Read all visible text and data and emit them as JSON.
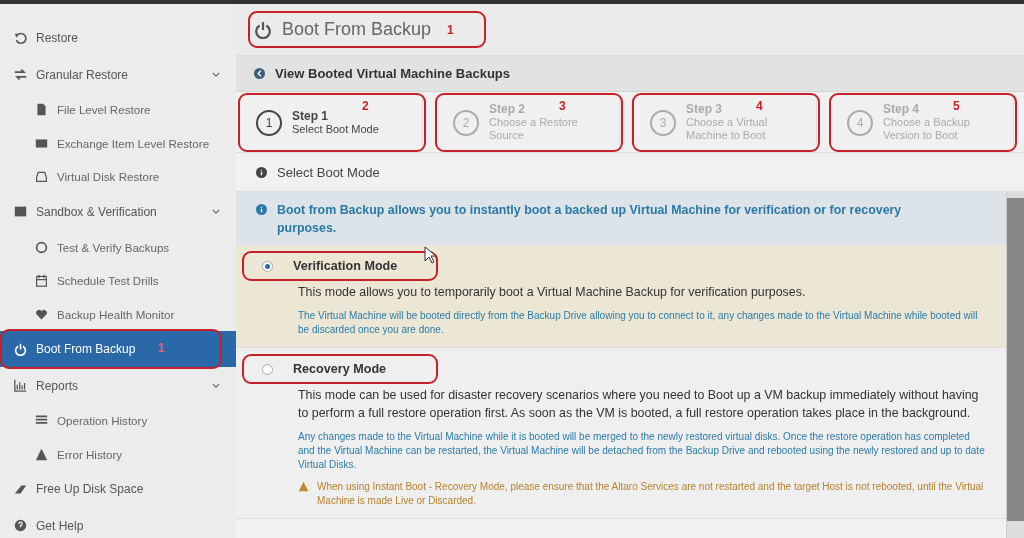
{
  "sidebar": {
    "items": [
      {
        "label": "Restore",
        "selected": false
      },
      {
        "label": "Granular Restore",
        "selected": false,
        "expanded": true,
        "children": [
          {
            "label": "File Level Restore",
            "selected": false
          },
          {
            "label": "Exchange Item Level Restore",
            "selected": false
          },
          {
            "label": "Virtual Disk Restore",
            "selected": false
          }
        ]
      },
      {
        "label": "Sandbox & Verification",
        "selected": false,
        "expanded": true,
        "children": [
          {
            "label": "Test & Verify Backups",
            "selected": false
          },
          {
            "label": "Schedule Test Drills",
            "selected": false
          },
          {
            "label": "Backup Health Monitor",
            "selected": false
          }
        ]
      },
      {
        "label": "Boot From Backup",
        "selected": true,
        "highlighted": true,
        "callout": "1"
      },
      {
        "label": "Reports",
        "selected": false,
        "expanded": true,
        "children": [
          {
            "label": "Operation History",
            "selected": false
          },
          {
            "label": "Error History",
            "selected": false
          }
        ]
      },
      {
        "label": "Free Up Disk Space",
        "selected": false
      },
      {
        "label": "Get Help",
        "selected": false
      }
    ]
  },
  "page": {
    "title": "Boot From Backup",
    "callout": "1"
  },
  "back_link": "View Booted Virtual Machine Backups",
  "steps": [
    {
      "number": "1",
      "title": "Step 1",
      "subtitle": "Select Boot Mode",
      "selected": true,
      "callout": "2"
    },
    {
      "number": "2",
      "title": "Step 2",
      "subtitle": "Choose a Restore Source",
      "selected": false,
      "callout": "3"
    },
    {
      "number": "3",
      "title": "Step 3",
      "subtitle": "Choose a Virtual Machine to Boot",
      "selected": false,
      "callout": "4"
    },
    {
      "number": "4",
      "title": "Step 4",
      "subtitle": "Choose a Backup Version to Boot",
      "selected": false,
      "callout": "5"
    }
  ],
  "section": {
    "title": "Select Boot Mode"
  },
  "info": "Boot from Backup allows you to instantly boot a backed up Virtual Machine for verification or for recovery purposes.",
  "modes": [
    {
      "label": "Verification Mode",
      "selected": true,
      "highlighted": true,
      "description": "This mode allows you to temporarily boot a Virtual Machine Backup for verification purposes.",
      "note": "The Virtual Machine will be booted directly from the Backup Drive allowing you to connect to it, any changes made to the Virtual Machine while booted will be discarded once you are done."
    },
    {
      "label": "Recovery Mode",
      "selected": false,
      "highlighted": true,
      "description": "This mode can be used for disaster recovery scenarios where you need to Boot up a VM backup immediately without having to perform a full restore operation first. As soon as the VM is booted, a full restore operation takes place in the background.",
      "note": "Any changes made to the Virtual Machine while it is booted will be merged to the newly restored virtual disks. Once the restore operation has completed and the Virtual Machine can be restarted, the Virtual Machine will be detached from the Backup Drive and rebooted using the newly restored and up to date Virtual Disks.",
      "warning": "When using Instant Boot - Recovery Mode, please ensure that the Altaro Services are not restarted and the target Host is not rebooted, until the Virtual Machine is made Live or Discarded."
    }
  ]
}
